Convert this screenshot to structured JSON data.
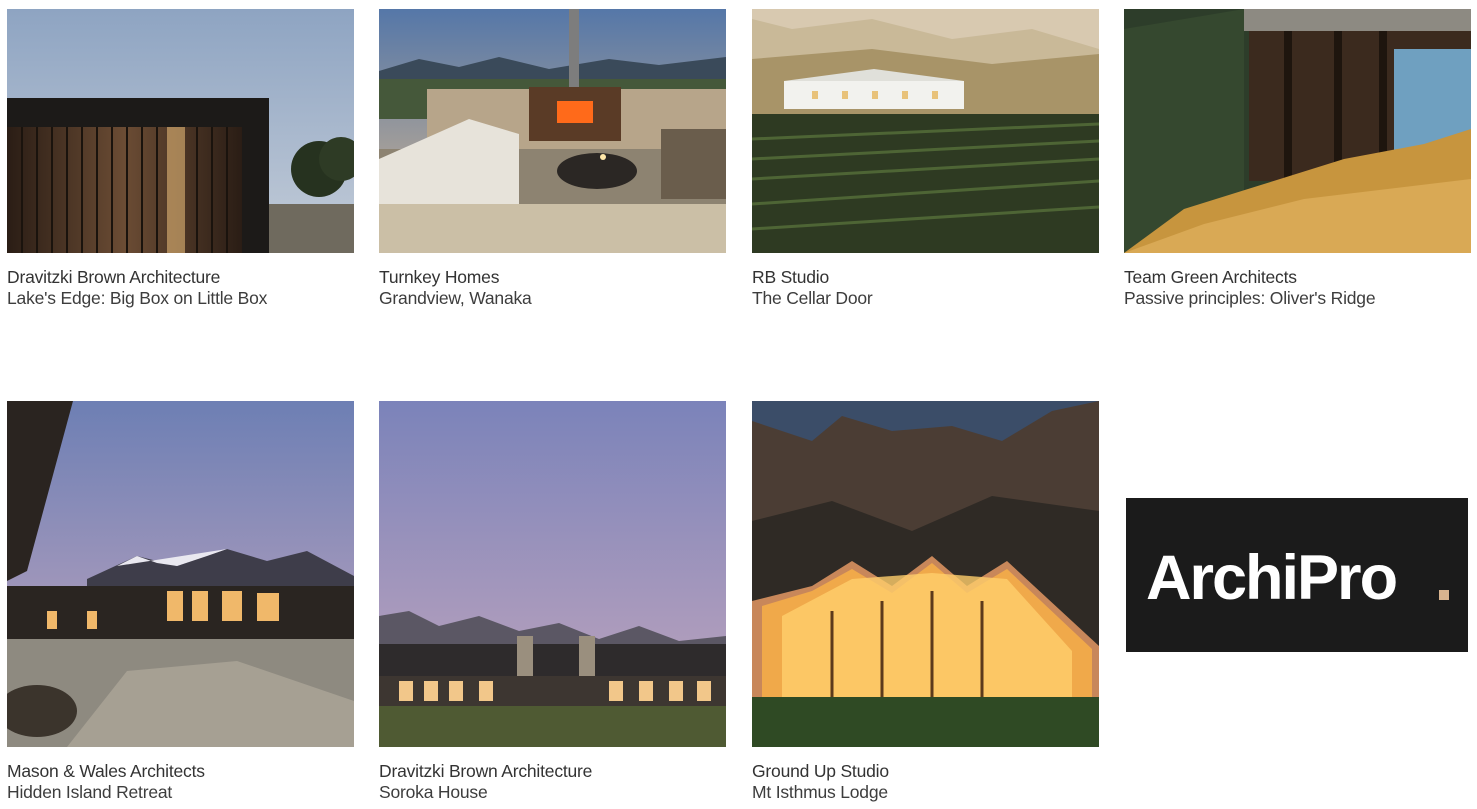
{
  "brand": {
    "name": "ArchiPro",
    "logo_bg": "#1b1b1b",
    "logo_dot": "#d8b48f"
  },
  "projects": [
    {
      "firm": "Dravitzki Brown Architecture",
      "project": "Lake's Edge: Big Box on Little Box"
    },
    {
      "firm": "Turnkey Homes",
      "project": "Grandview, Wanaka"
    },
    {
      "firm": "RB Studio",
      "project": "The Cellar Door"
    },
    {
      "firm": "Team Green Architects",
      "project": "Passive principles: Oliver's Ridge"
    },
    {
      "firm": "Mason & Wales Architects",
      "project": "Hidden Island Retreat"
    },
    {
      "firm": "Dravitzki Brown Architecture",
      "project": "Soroka House"
    },
    {
      "firm": "Ground Up Studio",
      "project": "Mt Isthmus Lodge"
    }
  ]
}
